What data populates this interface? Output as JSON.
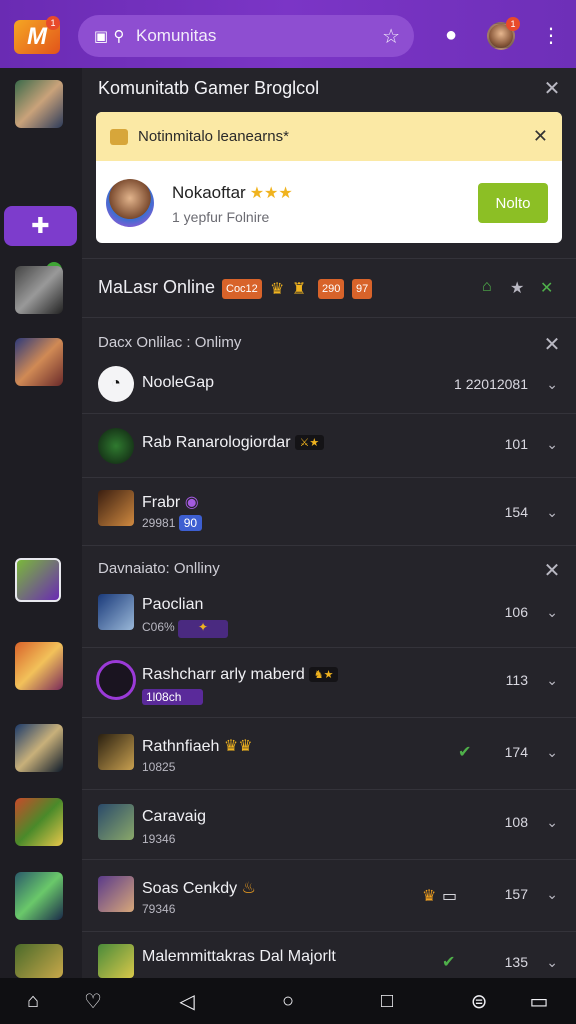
{
  "topbar": {
    "logo_text": "M",
    "logo_badge": "1",
    "search_text": "Komunitas",
    "avatar_badge": "1"
  },
  "panel": {
    "title": "Komunitatb Gamer Broglcol",
    "notif_header": "Notinmitalo leanearns*",
    "notif_name": "Nokaoftar",
    "notif_stars": "★★★",
    "notif_sub": "1 yepfur Folnire",
    "notif_button": "Nolto"
  },
  "online_section": {
    "title": "MaLasr Online",
    "tag1": "Coc12",
    "tag2": "290",
    "tag3": "97"
  },
  "group1": {
    "title": "Dacx Onlilac : Onlimy",
    "rows": [
      {
        "name": "NooleGap",
        "value": "1 22012081"
      },
      {
        "name": "Rab Ranarologiordar",
        "value": "101"
      },
      {
        "name": "Frabr",
        "sub": "29981",
        "sub_badge": "90",
        "value": "154"
      }
    ]
  },
  "group2": {
    "title": "Davnaiato: Onlliny",
    "rows": [
      {
        "name": "Paoclian",
        "sub": "C06%",
        "value": "106"
      },
      {
        "name": "Rashcharr arly maberd",
        "sub": "1l08ch",
        "value": "113"
      },
      {
        "name": "Rathnfiaeh",
        "sub": "10825",
        "value": "174"
      },
      {
        "name": "Caravaig",
        "sub": "19346",
        "value": "108"
      },
      {
        "name": "Soas Cenkdy",
        "sub": "79346",
        "value": "157"
      },
      {
        "name": "Malemmittakras Dal Majorlt",
        "value": "135"
      }
    ]
  },
  "colors": {
    "topbar": "#7b35c6",
    "accent_green": "#8cbf25",
    "notif_header": "#fbe9a5",
    "panel": "#25242a"
  }
}
